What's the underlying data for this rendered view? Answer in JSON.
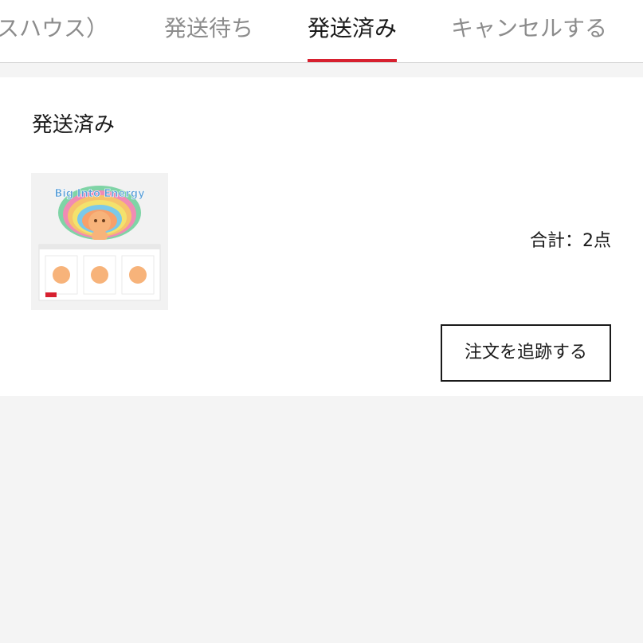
{
  "tabs": [
    {
      "label": "スハウス）",
      "active": false
    },
    {
      "label": "発送待ち",
      "active": false
    },
    {
      "label": "発送済み",
      "active": true
    },
    {
      "label": "キャンセルする",
      "active": false
    }
  ],
  "order": {
    "status_title": "発送済み",
    "product_image": {
      "banner_text": "Big Into Energy",
      "sticker_label": "POP MART"
    },
    "total_label": "合計：",
    "total_value": "2点",
    "track_button_label": "注文を追跡する"
  },
  "colors": {
    "accent": "#d7202f",
    "page_background": "#f4f4f4",
    "card_background": "#ffffff",
    "text_primary": "#1a1a1a",
    "text_secondary": "#8c8c8c"
  }
}
